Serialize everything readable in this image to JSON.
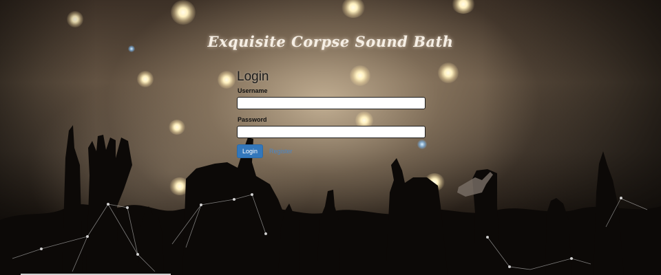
{
  "site": {
    "title": "Exquisite Corpse Sound Bath"
  },
  "login": {
    "heading": "Login",
    "username_label": "Username",
    "username_value": "",
    "password_label": "Password",
    "password_value": "",
    "submit_label": "Login",
    "register_label": "Register"
  },
  "colors": {
    "button": "#3377bb",
    "link": "#4a86c6",
    "title_text": "#f5eee4"
  },
  "background": {
    "description_icon": "concert-crowd-background"
  }
}
